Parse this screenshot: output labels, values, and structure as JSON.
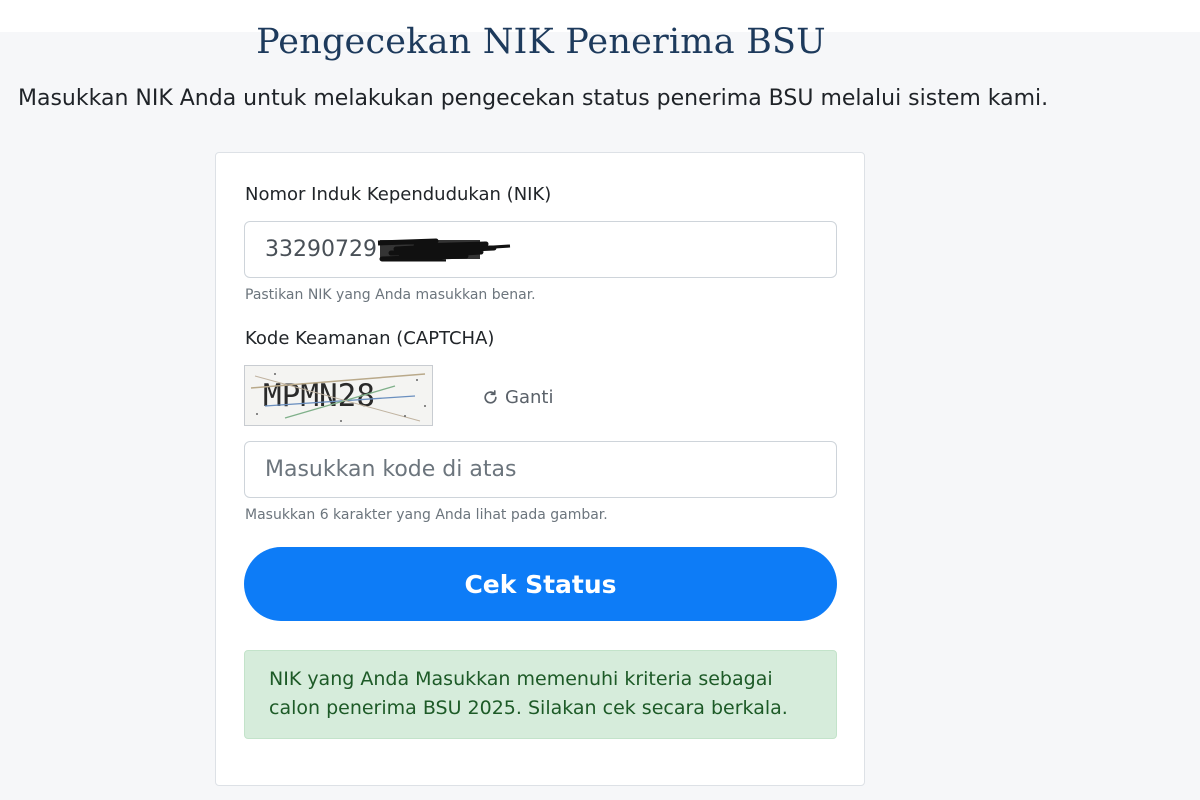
{
  "page": {
    "title": "Pengecekan NIK Penerima BSU",
    "subtitle": "Masukkan NIK Anda untuk melakukan pengecekan status penerima BSU melalui sistem kami."
  },
  "form": {
    "nik": {
      "label": "Nomor Induk Kependudukan (NIK)",
      "value": "33290729",
      "help": "Pastikan NIK yang Anda masukkan benar."
    },
    "captcha": {
      "label": "Kode Keamanan (CAPTCHA)",
      "code": "MPMN28",
      "refresh_label": "Ganti",
      "placeholder": "Masukkan kode di atas",
      "help": "Masukkan 6 karakter yang Anda lihat pada gambar."
    },
    "submit_label": "Cek Status"
  },
  "result": {
    "message": "NIK yang Anda Masukkan memenuhi kriteria sebagai calon penerima BSU 2025. Silakan cek secara berkala."
  },
  "colors": {
    "primary": "#0d7cf7",
    "success_bg": "#d6ecdb",
    "success_text": "#1d5a27",
    "title": "#1d3a5c"
  }
}
